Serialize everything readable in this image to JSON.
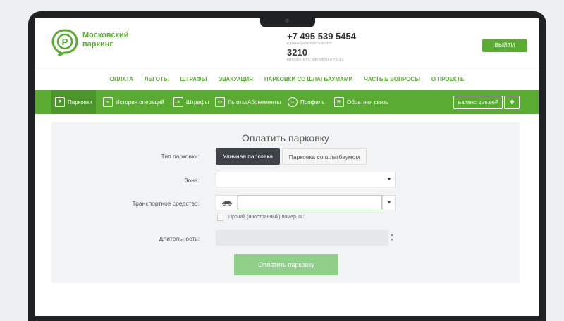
{
  "header": {
    "logo_line1": "Московский",
    "logo_line2": "паркинг",
    "phone_main": "+7 495 539 5454",
    "phone_main_sub": "ЕДИНЫЙ КОНТАКТ-ЦЕНТР",
    "phone_short": "3210",
    "phone_short_sub": "БИЛАЙН, МТС, МЕГАФОН И TELE2",
    "exit_label": "ВЫЙТИ"
  },
  "topnav": [
    "ОПЛАТА",
    "ЛЬГОТЫ",
    "ШТРАФЫ",
    "ЭВАКУАЦИЯ",
    "ПАРКОВКИ СО ШЛАГБАУМАМИ",
    "ЧАСТЫЕ ВОПРОСЫ",
    "О ПРОЕКТЕ"
  ],
  "greenbar": {
    "items": [
      {
        "label": "Парковки",
        "icon": "parking-icon"
      },
      {
        "label": "История операций",
        "icon": "history-icon"
      },
      {
        "label": "Штрафы",
        "icon": "fines-icon"
      },
      {
        "label": "Льготы/Абонементы",
        "icon": "benefits-icon"
      },
      {
        "label": "Профиль",
        "icon": "profile-icon"
      },
      {
        "label": "Обратная связь",
        "icon": "feedback-icon"
      }
    ],
    "balance": "Баланс: 136.86₽",
    "plus": "+"
  },
  "form": {
    "title": "Оплатить парковку",
    "type_label": "Тип парковки:",
    "type_street": "Уличная парковка",
    "type_barrier": "Парковка со шлагбаумом",
    "zone_label": "Зона:",
    "vehicle_label": "Транспортное средство:",
    "foreign_plate_label": "Прочий (иностранный) номер ТС",
    "duration_label": "Длительность:",
    "pay_button": "Оплатить парковку"
  },
  "colors": {
    "brand_green": "#5aab32",
    "active_segment": "#3d4348",
    "pay_button": "#8fcf8a"
  }
}
